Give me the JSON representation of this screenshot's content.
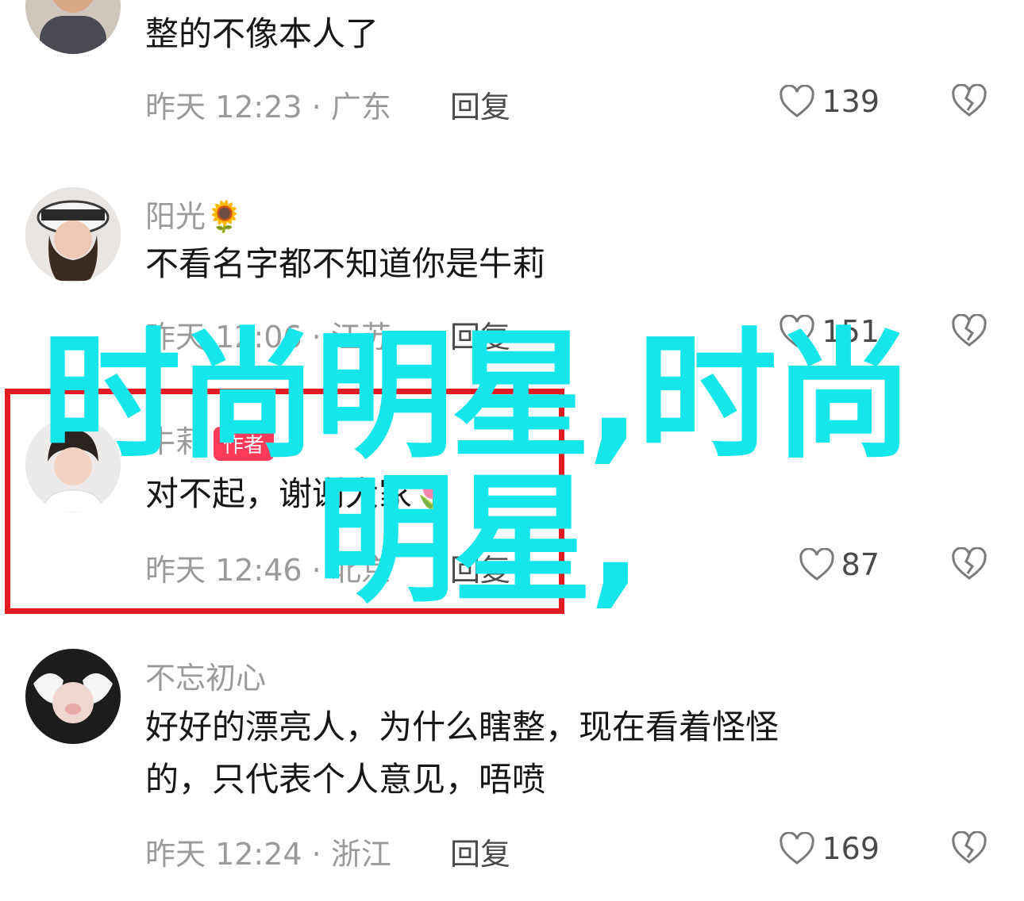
{
  "comments": [
    {
      "username": "",
      "text": "整的不像本人了",
      "meta": "昨天 12:23 · 广东",
      "reply": "回复",
      "likes": "139"
    },
    {
      "username": "阳光",
      "username_emoji": "🌻",
      "text": "不看名字都不知道你是牛莉",
      "meta": "昨天 12:06 · 江苏",
      "reply": "回复",
      "likes": "151"
    },
    {
      "username": "牛莉",
      "badge": "作者",
      "text": "对不起，谢谢大家",
      "text_emoji": "🌷",
      "meta": "昨天 12:46 · 北京",
      "reply": "回复",
      "likes": "87"
    },
    {
      "username": "不忘初心",
      "text_line1": "好好的漂亮人，为什么瞎整，现在看着怪怪",
      "text_line2": "的，只代表个人意见，唔喷",
      "meta": "昨天 12:24 · 浙江",
      "reply": "回复",
      "likes": "169"
    }
  ],
  "overlay": {
    "line1": "时尚明星,时尚",
    "line2": "明星,"
  },
  "colors": {
    "overlay": "#14e6e9",
    "highlight_border": "#e31b23",
    "badge": "#ff3b5c",
    "meta_text": "#9a9a9a"
  },
  "icons": {
    "like": "heart-outline-icon",
    "dislike": "broken-heart-icon"
  }
}
